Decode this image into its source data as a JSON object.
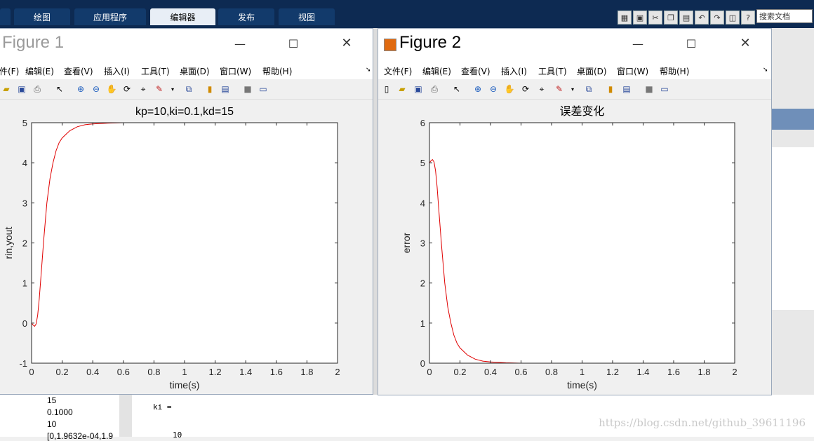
{
  "ribbon": {
    "tabs": [
      "绘图",
      "应用程序",
      "编辑器",
      "发布",
      "视图"
    ],
    "active_tab": "编辑器",
    "search_placeholder": "搜索文档"
  },
  "figure1": {
    "title": "Figure 1",
    "menu": [
      "件(F)",
      "编辑(E)",
      "查看(V)",
      "插入(I)",
      "工具(T)",
      "桌面(D)",
      "窗口(W)",
      "帮助(H)"
    ],
    "chart_data": {
      "type": "line",
      "title": "kp=10,ki=0.1,kd=15",
      "xlabel": "time(s)",
      "ylabel": "rin,yout",
      "xlim": [
        0,
        2
      ],
      "ylim": [
        -1,
        5
      ],
      "xticks": [
        "0",
        "0.2",
        "0.4",
        "0.6",
        "0.8",
        "1",
        "1.2",
        "1.4",
        "1.6",
        "1.8",
        "2"
      ],
      "yticks": [
        "-1",
        "0",
        "1",
        "2",
        "3",
        "4",
        "5"
      ],
      "series": [
        {
          "color": "#0000ff",
          "x": [
            0,
            2
          ],
          "y": [
            5,
            5
          ]
        },
        {
          "color": "#e00000",
          "x": [
            0,
            0.01,
            0.02,
            0.03,
            0.04,
            0.05,
            0.06,
            0.08,
            0.1,
            0.12,
            0.14,
            0.16,
            0.18,
            0.2,
            0.25,
            0.3,
            0.35,
            0.4,
            0.5,
            0.6,
            0.8,
            1.0,
            1.5,
            2.0
          ],
          "y": [
            0,
            -0.05,
            -0.08,
            -0.02,
            0.2,
            0.6,
            1.1,
            2.1,
            3.0,
            3.6,
            4.0,
            4.3,
            4.5,
            4.62,
            4.8,
            4.9,
            4.95,
            4.97,
            4.99,
            5.0,
            5.0,
            5.0,
            5.0,
            5.0
          ]
        }
      ],
      "grid": false
    }
  },
  "figure2": {
    "title": "Figure 2",
    "menu": [
      "文件(F)",
      "编辑(E)",
      "查看(V)",
      "插入(I)",
      "工具(T)",
      "桌面(D)",
      "窗口(W)",
      "帮助(H)"
    ],
    "chart_data": {
      "type": "line",
      "title": "误差变化",
      "xlabel": "time(s)",
      "ylabel": "error",
      "xlim": [
        0,
        2
      ],
      "ylim": [
        0,
        6
      ],
      "xticks": [
        "0",
        "0.2",
        "0.4",
        "0.6",
        "0.8",
        "1",
        "1.2",
        "1.4",
        "1.6",
        "1.8",
        "2"
      ],
      "yticks": [
        "0",
        "1",
        "2",
        "3",
        "4",
        "5",
        "6"
      ],
      "series": [
        {
          "color": "#e00000",
          "x": [
            0,
            0.01,
            0.02,
            0.03,
            0.04,
            0.05,
            0.06,
            0.08,
            0.1,
            0.12,
            0.14,
            0.16,
            0.18,
            0.2,
            0.25,
            0.3,
            0.35,
            0.4,
            0.5,
            0.6,
            0.8,
            1.0,
            1.5,
            2.0
          ],
          "y": [
            5.0,
            5.05,
            5.08,
            5.02,
            4.8,
            4.4,
            3.9,
            2.9,
            2.0,
            1.4,
            1.0,
            0.7,
            0.5,
            0.38,
            0.2,
            0.1,
            0.05,
            0.03,
            0.01,
            0.0,
            0.0,
            0.0,
            0.0,
            0.0
          ]
        }
      ],
      "grid": false
    }
  },
  "workspace": {
    "values": [
      "15",
      "0.1000",
      "10",
      "[0,1.9632e-04,1.9"
    ]
  },
  "command": {
    "line1": "ki =",
    "line2": "10"
  },
  "watermark": "https://blog.csdn.net/github_39611196"
}
